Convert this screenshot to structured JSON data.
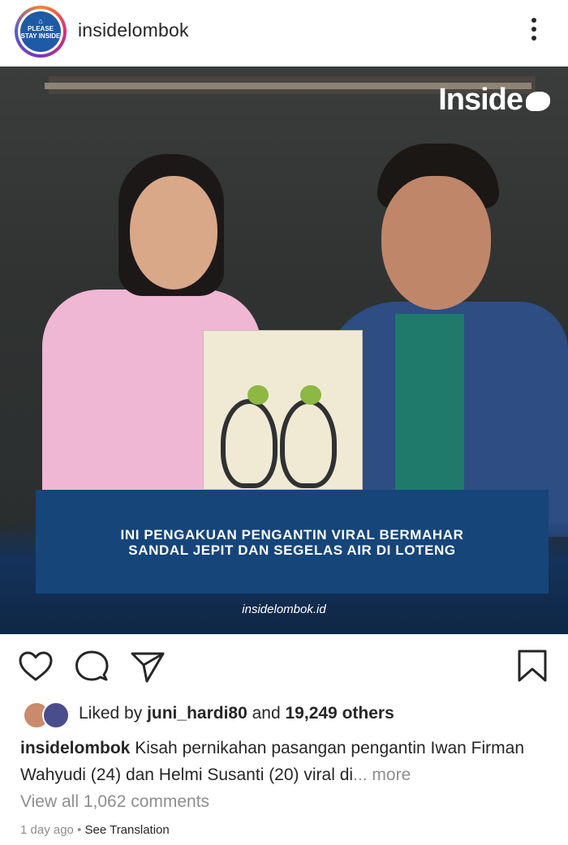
{
  "header": {
    "avatar_text": "PLEASE STAY INSIDE",
    "username": "insidelombok"
  },
  "post": {
    "brand": "Inside",
    "headline": "INI PENGAKUAN PENGANTIN VIRAL BERMAHAR\nSANDAL JEPIT DAN SEGELAS AIR DI LOTENG",
    "site": "insidelombok.id"
  },
  "actions": {
    "icons": [
      "heart-icon",
      "comment-icon",
      "share-icon",
      "bookmark-icon"
    ]
  },
  "likes": {
    "prefix": "Liked by",
    "user": "juni_hardi80",
    "conj": "and",
    "others": "19,249 others"
  },
  "caption": {
    "username": "insidelombok",
    "text": "Kisah pernikahan pasangan pengantin Iwan Firman Wahyudi (24) dan Helmi Susanti (20) viral di",
    "more": "... more"
  },
  "comments": {
    "label": "View all 1,062 comments"
  },
  "meta": {
    "time": "1 day ago",
    "separator": "•",
    "translation": "See Translation"
  },
  "colors": {
    "headline_bg": "#16457a",
    "text": "#262626",
    "muted": "#8e8e8e"
  }
}
